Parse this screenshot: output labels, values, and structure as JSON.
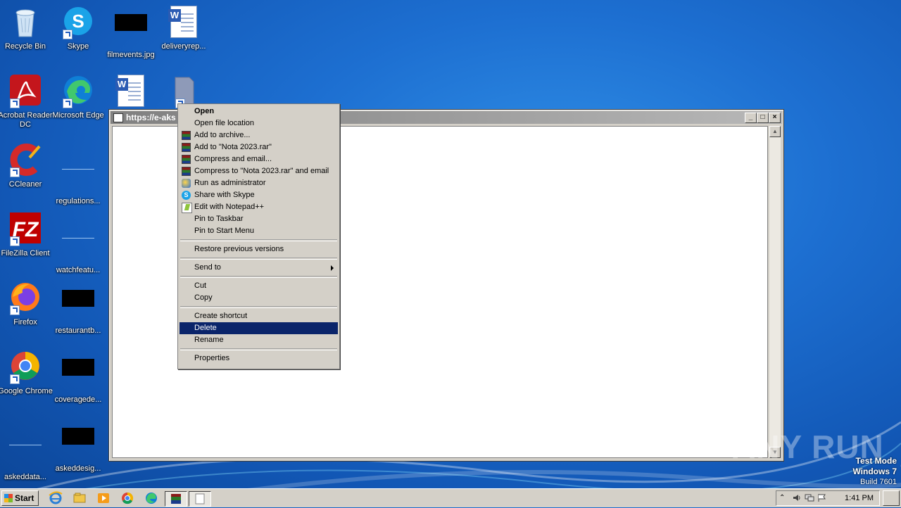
{
  "desktop": {
    "icons": [
      {
        "label": "Recycle Bin"
      },
      {
        "label": "Skype"
      },
      {
        "label": "filmevents.jpg"
      },
      {
        "label": "deliveryrep..."
      },
      {
        "label": "Acrobat Reader DC"
      },
      {
        "label": "Microsoft Edge"
      },
      {
        "label": "CCleaner"
      },
      {
        "label": "regulations..."
      },
      {
        "label": "FileZilla Client"
      },
      {
        "label": "watchfeatu..."
      },
      {
        "label": "Firefox"
      },
      {
        "label": "restaurantb..."
      },
      {
        "label": "Google Chrome"
      },
      {
        "label": "coveragede..."
      },
      {
        "label": "askeddata..."
      },
      {
        "label": "askeddesig..."
      }
    ]
  },
  "window": {
    "title": "https://e-aks",
    "minimize": "_",
    "maximize": "□",
    "close": "×"
  },
  "context_menu": {
    "items": [
      {
        "label": "Open",
        "bold": true
      },
      {
        "label": "Open file location"
      },
      {
        "label": "Add to archive..."
      },
      {
        "label": "Add to \"Nota 2023.rar\""
      },
      {
        "label": "Compress and email..."
      },
      {
        "label": "Compress to \"Nota 2023.rar\" and email"
      },
      {
        "label": "Run as administrator"
      },
      {
        "label": "Share with Skype"
      },
      {
        "label": "Edit with Notepad++"
      },
      {
        "label": "Pin to Taskbar"
      },
      {
        "label": "Pin to Start Menu"
      },
      {
        "label": "Restore previous versions"
      },
      {
        "label": "Send to"
      },
      {
        "label": "Cut"
      },
      {
        "label": "Copy"
      },
      {
        "label": "Create shortcut"
      },
      {
        "label": "Delete",
        "selected": true
      },
      {
        "label": "Rename"
      },
      {
        "label": "Properties"
      }
    ]
  },
  "watermark": "ANY RUN",
  "test_mode": {
    "line1": "Test Mode",
    "line2": "Windows 7",
    "line3": "Build 7601"
  },
  "taskbar": {
    "start_label": "Start",
    "clock": "1:41 PM"
  },
  "colors": {
    "selection": "#0a246a",
    "desktop_blue": "#1d6fd1",
    "chrome_gray": "#d4d0c8"
  }
}
